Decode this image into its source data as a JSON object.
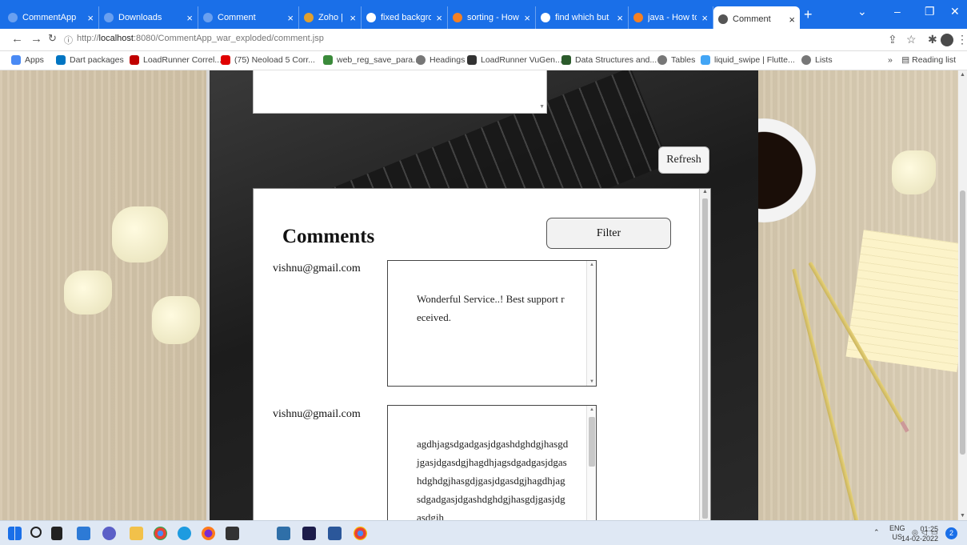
{
  "browser": {
    "tabs": [
      {
        "label": "CommentApp",
        "color": "#6aa0f0"
      },
      {
        "label": "Downloads",
        "color": "#6aa0f0"
      },
      {
        "label": "Comment",
        "color": "#6aa0f0"
      },
      {
        "label": "Zoho | Online",
        "color": "#e0a030"
      },
      {
        "label": "fixed backgro",
        "color": "#ffffff"
      },
      {
        "label": "sorting - How",
        "color": "#f48024"
      },
      {
        "label": "find which but",
        "color": "#ffffff"
      },
      {
        "label": "java - How to",
        "color": "#f48024"
      },
      {
        "label": "Comment",
        "color": "#555555"
      }
    ],
    "url_prefix": "http://",
    "url_host": "localhost",
    "url_rest": ":8080/CommentApp_war_exploded/comment.jsp",
    "bookmarks": [
      {
        "label": "Apps",
        "color": "#4a8af4"
      },
      {
        "label": "Dart packages",
        "color": "#0175c2"
      },
      {
        "label": "LoadRunner Correl...",
        "color": "#c00000"
      },
      {
        "label": "(75) Neoload 5 Corr...",
        "color": "#e00000"
      },
      {
        "label": "web_reg_save_para...",
        "color": "#3a8a3a"
      },
      {
        "label": "Headings",
        "color": "#777777"
      },
      {
        "label": "LoadRunner VuGen...",
        "color": "#333333"
      },
      {
        "label": "Data Structures and...",
        "color": "#2b5a2b"
      },
      {
        "label": "Tables",
        "color": "#777777"
      },
      {
        "label": "liquid_swipe | Flutte...",
        "color": "#42a5f5"
      },
      {
        "label": "Lists",
        "color": "#777777"
      }
    ],
    "overflow": "»",
    "reading_list": "Reading list"
  },
  "page": {
    "refresh_label": "Refresh",
    "comments_title": "Comments",
    "filter_label": "Filter",
    "comments": [
      {
        "email": "vishnu@gmail.com",
        "text": "Wonderful Service..! Best support received."
      },
      {
        "email": "vishnu@gmail.com",
        "text": "agdhjagsdgadgasjdgashdghdgjhasgdjgasjdgasdgjhagdhjagsdgadgasjdgashdghdgjhasgdjgasjdgasdgjhagdhjagsdgadgasjdgashdghdgjhasgdjgasjdgasdgjh"
      }
    ]
  },
  "taskbar": {
    "lang_top": "ENG",
    "lang_bottom": "US",
    "time": "01:25",
    "date": "14-02-2022",
    "notifications": "2"
  }
}
